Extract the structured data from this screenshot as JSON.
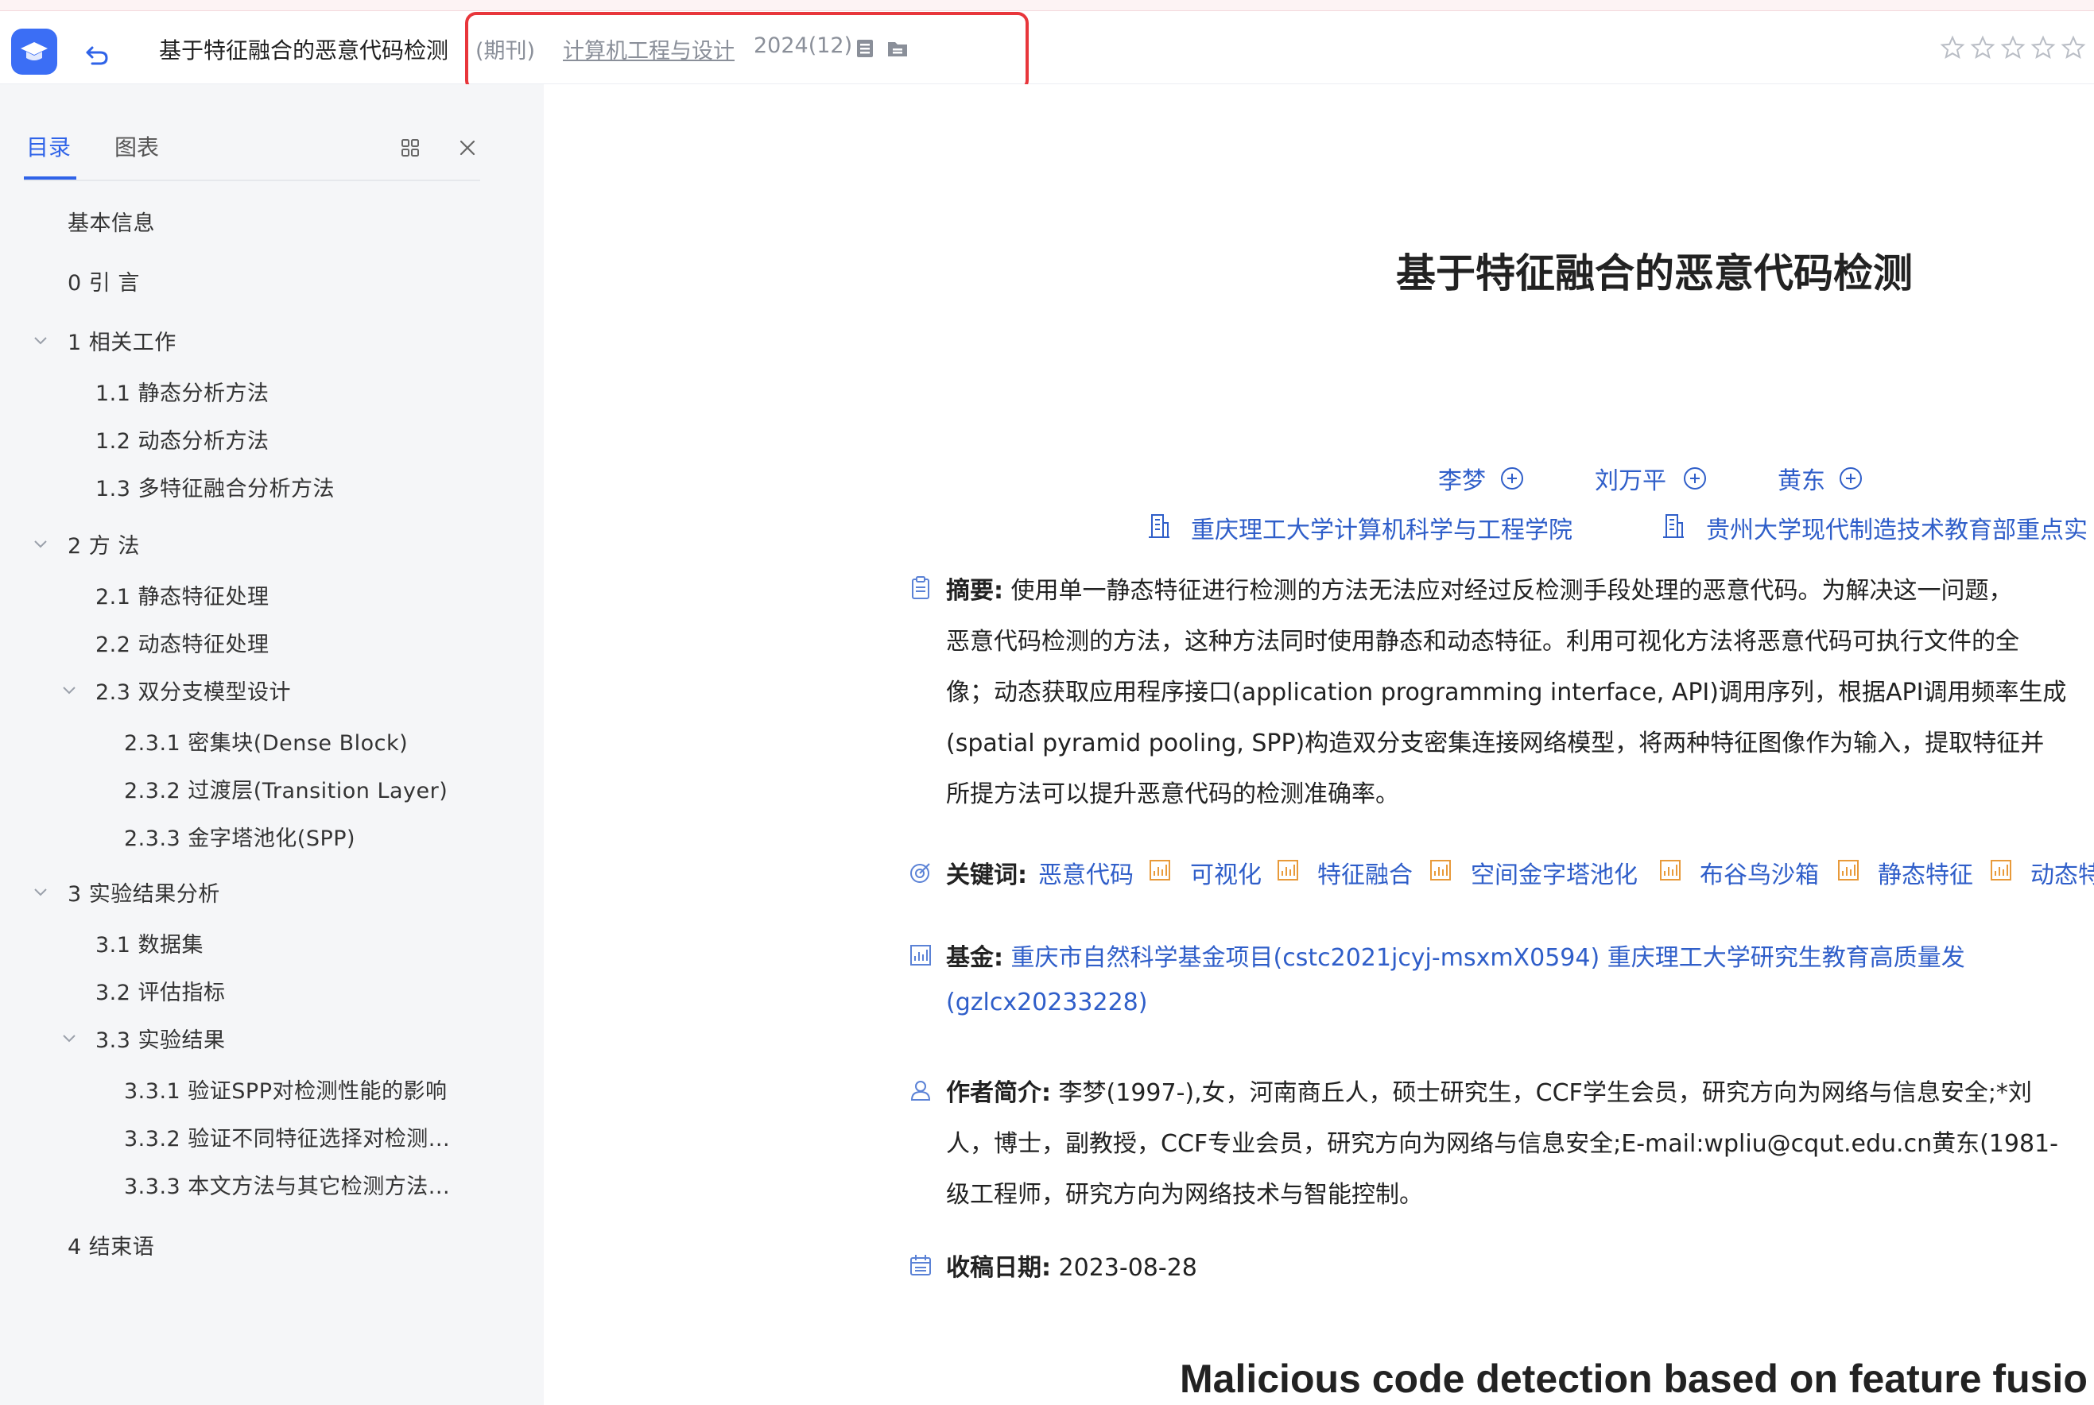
{
  "header": {
    "doc_title": "基于特征融合的恶意代码检测",
    "journal_type": "(期刊)",
    "journal_name": "计算机工程与设计",
    "journal_issue": "2024(12)",
    "rating_stars": 5,
    "accent_color": "#2f63e8",
    "highlight_color": "#e8363b"
  },
  "sidebar": {
    "tabs": [
      {
        "label": "目录",
        "active": true
      },
      {
        "label": "图表",
        "active": false
      }
    ],
    "toc": [
      {
        "label": "基本信息"
      },
      {
        "label": "0 引 言"
      },
      {
        "label": "1 相关工作",
        "expanded": true
      },
      {
        "label": "1.1 静态分析方法"
      },
      {
        "label": "1.2 动态分析方法"
      },
      {
        "label": "1.3 多特征融合分析方法"
      },
      {
        "label": "2 方 法",
        "expanded": true
      },
      {
        "label": "2.1 静态特征处理"
      },
      {
        "label": "2.2 动态特征处理"
      },
      {
        "label": "2.3 双分支模型设计",
        "expanded": true
      },
      {
        "label": "2.3.1 密集块(Dense Block)"
      },
      {
        "label": "2.3.2 过渡层(Transition Layer)"
      },
      {
        "label": "2.3.3 金字塔池化(SPP)"
      },
      {
        "label": "3 实验结果分析",
        "expanded": true
      },
      {
        "label": "3.1 数据集"
      },
      {
        "label": "3.2 评估指标"
      },
      {
        "label": "3.3 实验结果",
        "expanded": true
      },
      {
        "label": "3.3.1 验证SPP对检测性能的影响"
      },
      {
        "label": "3.3.2 验证不同特征选择对检测..."
      },
      {
        "label": "3.3.3 本文方法与其它检测方法..."
      },
      {
        "label": "4 结束语"
      }
    ]
  },
  "article": {
    "title": "基于特征融合的恶意代码检测",
    "authors": [
      "李梦",
      "刘万平",
      "黄东"
    ],
    "affiliations": [
      "重庆理工大学计算机科学与工程学院",
      "贵州大学现代制造技术教育部重点实"
    ],
    "abstract_label": "摘要:",
    "abstract_lines": [
      "使用单一静态特征进行检测的方法无法应对经过反检测手段处理的恶意代码。为解决这一问题，",
      "恶意代码检测的方法，这种方法同时使用静态和动态特征。利用可视化方法将恶意代码可执行文件的全",
      "像；动态获取应用程序接口(application programming interface, API)调用序列，根据API调用频率生成",
      "(spatial pyramid pooling, SPP)构造双分支密集连接网络模型，将两种特征图像作为输入，提取特征并",
      "所提方法可以提升恶意代码的检测准确率。"
    ],
    "keywords_label": "关键词:",
    "keywords": [
      "恶意代码",
      "可视化",
      "特征融合",
      "空间金字塔池化",
      "布谷鸟沙箱",
      "静态特征",
      "动态特"
    ],
    "fund_label": "基金:",
    "fund_line1": "重庆市自然科学基金项目(cstc2021jcyj-msxmX0594) 重庆理工大学研究生教育高质量发",
    "fund_line2": "(gzlcx20233228)",
    "bio_label": "作者简介:",
    "bio_lines": [
      "李梦(1997-),女，河南商丘人，硕士研究生，CCF学生会员，研究方向为网络与信息安全;*刘",
      "人，博士，副教授，CCF专业会员，研究方向为网络与信息安全;E-mail:wpliu@cqut.edu.cn黄东(1981-",
      "级工程师，研究方向为网络技术与智能控制。"
    ],
    "received_label": "收稿日期:",
    "received_date": "2023-08-28",
    "english_title": "Malicious code detection based on feature fusio"
  }
}
